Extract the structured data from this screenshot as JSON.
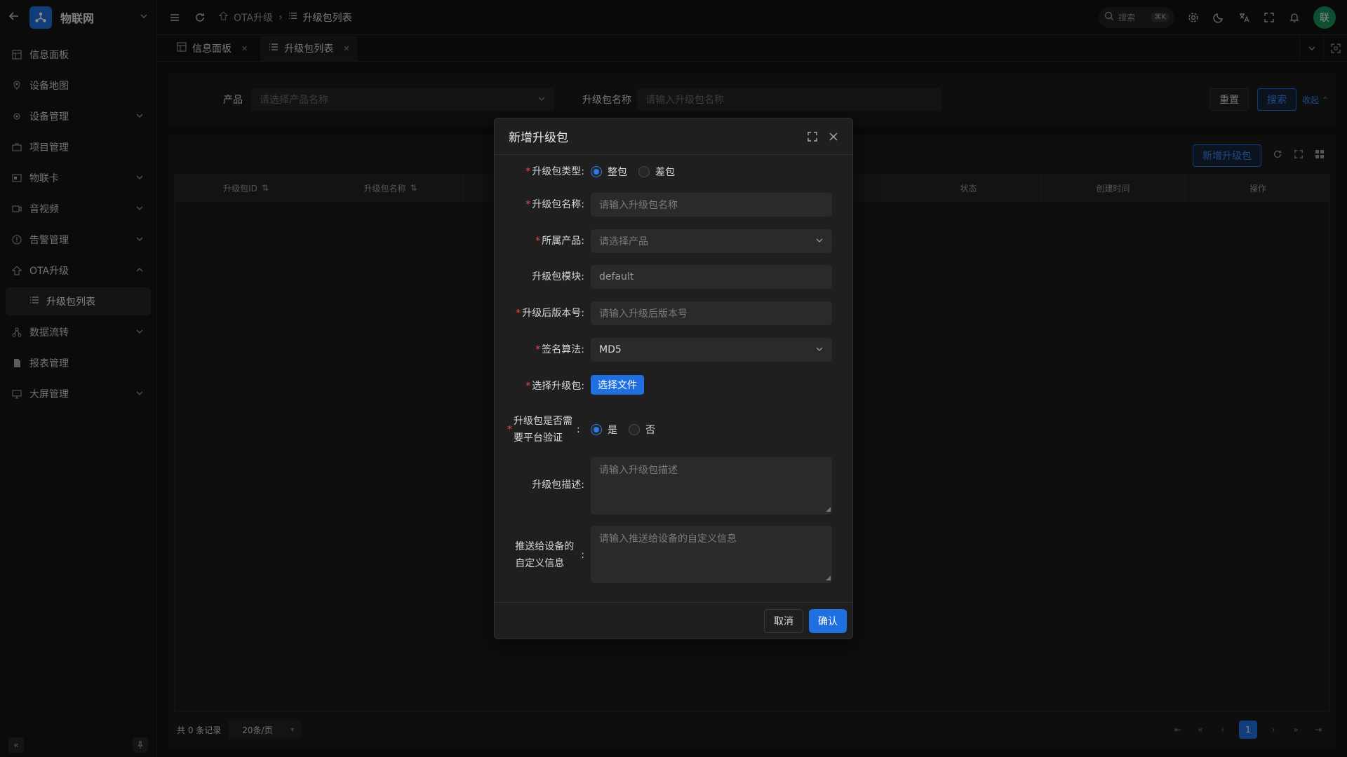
{
  "app": {
    "name": "物联网",
    "avatar_text": "联"
  },
  "sidebar": {
    "items": [
      {
        "label": "信息面板",
        "icon": "dashboard-icon",
        "expandable": false
      },
      {
        "label": "设备地图",
        "icon": "map-icon",
        "expandable": false
      },
      {
        "label": "设备管理",
        "icon": "device-icon",
        "expandable": true
      },
      {
        "label": "项目管理",
        "icon": "briefcase-icon",
        "expandable": false
      },
      {
        "label": "物联卡",
        "icon": "simcard-icon",
        "expandable": true
      },
      {
        "label": "音视频",
        "icon": "video-icon",
        "expandable": true
      },
      {
        "label": "告警管理",
        "icon": "alert-icon",
        "expandable": true
      },
      {
        "label": "OTA升级",
        "icon": "upgrade-icon",
        "expandable": true,
        "expanded": true
      },
      {
        "label": "数据流转",
        "icon": "flow-icon",
        "expandable": true
      },
      {
        "label": "报表管理",
        "icon": "report-icon",
        "expandable": false
      },
      {
        "label": "大屏管理",
        "icon": "screen-icon",
        "expandable": true
      }
    ],
    "sub_item": "升级包列表"
  },
  "header": {
    "breadcrumb": [
      "OTA升级",
      "升级包列表"
    ],
    "search_placeholder": "搜索",
    "search_shortcut": "⌘K"
  },
  "tabs": [
    {
      "label": "信息面板",
      "active": false
    },
    {
      "label": "升级包列表",
      "active": true
    }
  ],
  "search_panel": {
    "product_label": "产品",
    "product_placeholder": "请选择产品名称",
    "name_label": "升级包名称",
    "name_placeholder": "请输入升级包名称",
    "reset": "重置",
    "search": "搜索",
    "collapse": "收起"
  },
  "table": {
    "add_button": "新增升级包",
    "columns": [
      "升级包ID",
      "升级包名称",
      "",
      "",
      "",
      "状态",
      "创建时间",
      "操作"
    ],
    "total_text": "共 0 条记录",
    "page_size": "20条/页",
    "current_page": "1"
  },
  "modal": {
    "title": "新增升级包",
    "fields": {
      "type": {
        "label": "升级包类型",
        "options": [
          "整包",
          "差包"
        ],
        "selected": "整包"
      },
      "name": {
        "label": "升级包名称",
        "placeholder": "请输入升级包名称"
      },
      "product": {
        "label": "所属产品",
        "placeholder": "请选择产品"
      },
      "module": {
        "label": "升级包模块",
        "value": "default"
      },
      "version": {
        "label": "升级后版本号",
        "placeholder": "请输入升级后版本号"
      },
      "sign": {
        "label": "签名算法",
        "value": "MD5"
      },
      "file": {
        "label": "选择升级包",
        "button": "选择文件"
      },
      "verify": {
        "label_line1": "升级包是否需",
        "label_line2": "要平台验证",
        "options": [
          "是",
          "否"
        ],
        "selected": "是"
      },
      "desc": {
        "label": "升级包描述",
        "placeholder": "请输入升级包描述"
      },
      "custom": {
        "label_line1": "推送给设备的",
        "label_line2": "自定义信息",
        "placeholder": "请输入推送给设备的自定义信息"
      }
    },
    "cancel": "取消",
    "confirm": "确认"
  },
  "colors": {
    "accent": "#1f6fe0",
    "required": "#f04848",
    "avatar": "#1a8f5a"
  }
}
